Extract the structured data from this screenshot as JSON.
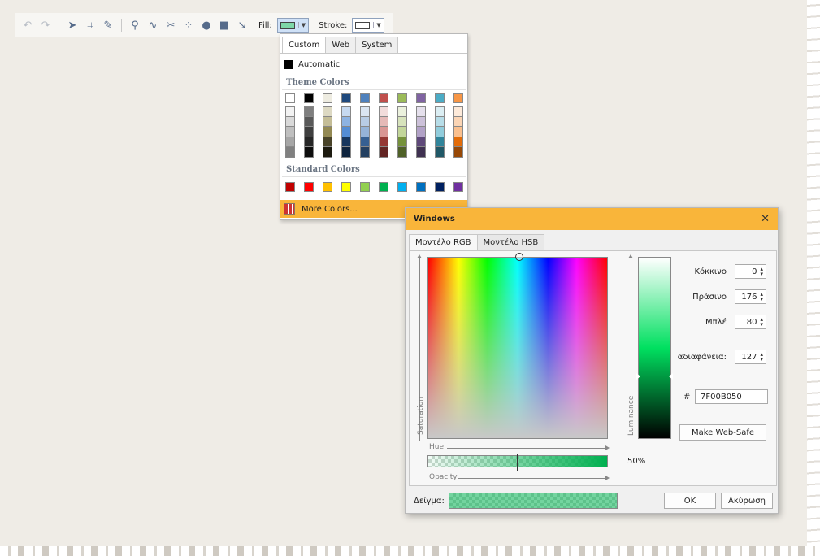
{
  "toolbar": {
    "icons": [
      "undo-icon",
      "redo-icon",
      "select-arrow-icon",
      "rectangle-select-icon",
      "pencil-icon",
      "marker-icon",
      "freehand-icon",
      "scissors-icon",
      "scatter-icon",
      "ellipse-icon",
      "square-icon",
      "line-icon"
    ],
    "fill_label": "Fill:",
    "stroke_label": "Stroke:",
    "fill_color": "#7fd8a8",
    "stroke_color": "#ffffff"
  },
  "dropdown": {
    "tabs": [
      "Custom",
      "Web",
      "System"
    ],
    "active_tab": "Custom",
    "automatic_label": "Automatic",
    "theme_section": "Theme Colors",
    "standard_section": "Standard Colors",
    "more_colors_label": "More Colors...",
    "theme_colors": [
      {
        "base": "#ffffff",
        "shades": [
          "#f2f2f2",
          "#d9d9d9",
          "#bfbfbf",
          "#a6a6a6",
          "#808080"
        ]
      },
      {
        "base": "#000000",
        "shades": [
          "#7f7f7f",
          "#595959",
          "#3f3f3f",
          "#262626",
          "#0d0d0d"
        ]
      },
      {
        "base": "#eeece1",
        "shades": [
          "#ddd9c3",
          "#c4bd97",
          "#938953",
          "#494429",
          "#1d1b10"
        ]
      },
      {
        "base": "#1f497d",
        "shades": [
          "#c6d9f0",
          "#8db3e2",
          "#548dd4",
          "#17365d",
          "#0f243e"
        ]
      },
      {
        "base": "#4f81bd",
        "shades": [
          "#dbe5f1",
          "#b8cce4",
          "#95b3d7",
          "#366092",
          "#244061"
        ]
      },
      {
        "base": "#c0504d",
        "shades": [
          "#f2dcdb",
          "#e5b9b7",
          "#d99694",
          "#953734",
          "#632423"
        ]
      },
      {
        "base": "#9bbb59",
        "shades": [
          "#ebf1dd",
          "#d7e3bc",
          "#c3d69b",
          "#76923c",
          "#4f6128"
        ]
      },
      {
        "base": "#8064a2",
        "shades": [
          "#e5e0ec",
          "#ccc1d9",
          "#b2a2c7",
          "#5f497a",
          "#3f3151"
        ]
      },
      {
        "base": "#4bacc6",
        "shades": [
          "#dbeef3",
          "#b7dde8",
          "#92cddc",
          "#31859b",
          "#205867"
        ]
      },
      {
        "base": "#f79646",
        "shades": [
          "#fdeada",
          "#fbd5b5",
          "#fac08f",
          "#e36c09",
          "#974806"
        ]
      }
    ],
    "standard_colors": [
      "#c00000",
      "#ff0000",
      "#ffc000",
      "#ffff00",
      "#92d050",
      "#00b050",
      "#00b0f0",
      "#0070c0",
      "#002060",
      "#7030a0"
    ]
  },
  "dialog": {
    "title": "Windows",
    "tabs": [
      "Μοντέλο RGB",
      "Μοντέλο HSB"
    ],
    "active_tab": "Μοντέλο RGB",
    "axis_saturation": "Saturation",
    "axis_hue": "Hue",
    "axis_opacity": "Opacity",
    "axis_luminance": "Luminance",
    "opacity_percent": "50%",
    "red_label": "Κόκκινο",
    "red_value": "0",
    "green_label": "Πράσινο",
    "green_value": "176",
    "blue_label": "Μπλέ",
    "blue_value": "80",
    "alpha_label": "αδιαφάνεια:",
    "alpha_value": "127",
    "hex_label": "#",
    "hex_value": "7F00B050",
    "web_safe_button": "Make Web-Safe",
    "sample_label": "Δείγμα:",
    "ok_button": "OK",
    "cancel_button": "Ακύρωση"
  }
}
